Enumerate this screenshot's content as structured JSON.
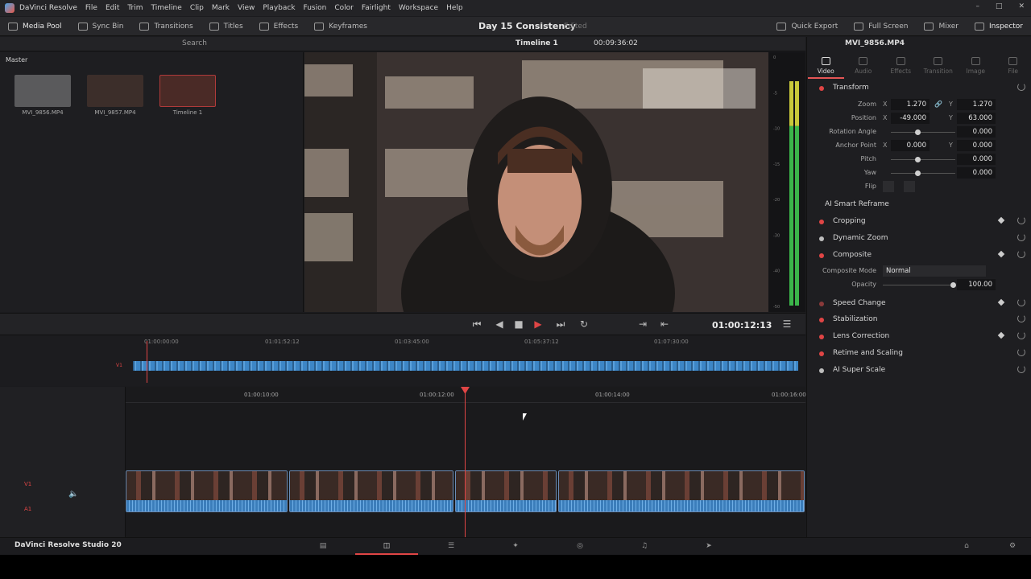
{
  "app": {
    "name": "DaVinci Resolve",
    "brand": "DaVinci Resolve Studio 20"
  },
  "menu": [
    "File",
    "Edit",
    "Trim",
    "Timeline",
    "Clip",
    "Mark",
    "View",
    "Playback",
    "Fusion",
    "Color",
    "Fairlight",
    "Workspace",
    "Help"
  ],
  "toolbar": {
    "left": [
      "Media Pool",
      "Sync Bin",
      "Transitions",
      "Titles",
      "Effects",
      "Keyframes"
    ],
    "project_title": "Day 15 Consistency",
    "project_status": "Edited",
    "right": [
      "Quick Export",
      "Full Screen",
      "Mixer",
      "Inspector"
    ]
  },
  "subbar": {
    "search_placeholder": "Search",
    "timeline_name": "Timeline 1",
    "timecode": "00:09:36:02"
  },
  "media_pool": {
    "bin": "Master",
    "clips": [
      {
        "name": "MVI_9856.MP4"
      },
      {
        "name": "MVI_9857.MP4"
      },
      {
        "name": "Timeline 1"
      }
    ]
  },
  "meter": {
    "scale": [
      "0",
      "-5",
      "-10",
      "-15",
      "-20",
      "-30",
      "-40",
      "-50"
    ],
    "level_green_pct": 0.72,
    "level_yellow_pct": 0.18
  },
  "transport": {
    "timecode": "01:00:12:13"
  },
  "ruler_upper": [
    "01:00:00:00",
    "01:01:52:12",
    "01:03:45:00",
    "01:05:37:12",
    "01:07:30:00"
  ],
  "ruler_lower": [
    "01:00:10:00",
    "01:00:12:00",
    "01:00:14:00",
    "01:00:16:00"
  ],
  "tracks": {
    "video": "V1",
    "audio": "A1"
  },
  "inspector": {
    "clip_name": "MVI_9856.MP4",
    "tabs": [
      "Video",
      "Audio",
      "Effects",
      "Transition",
      "Image",
      "File"
    ],
    "transform": {
      "title": "Transform",
      "zoom": {
        "label": "Zoom",
        "x": "1.270",
        "y": "1.270"
      },
      "position": {
        "label": "Position",
        "x": "-49.000",
        "y": "63.000"
      },
      "rotation": {
        "label": "Rotation Angle",
        "value": "0.000"
      },
      "anchor": {
        "label": "Anchor Point",
        "x": "0.000",
        "y": "0.000"
      },
      "pitch": {
        "label": "Pitch",
        "value": "0.000"
      },
      "yaw": {
        "label": "Yaw",
        "value": "0.000"
      },
      "flip": {
        "label": "Flip"
      },
      "axis_x": "X",
      "axis_y": "Y"
    },
    "ai_reframe": "AI Smart Reframe",
    "cropping": "Cropping",
    "dynamic_zoom": "Dynamic Zoom",
    "composite": {
      "title": "Composite",
      "mode_label": "Composite Mode",
      "mode": "Normal",
      "opacity_label": "Opacity",
      "opacity": "100.00"
    },
    "speed_change": "Speed Change",
    "stabilization": "Stabilization",
    "lens_correction": "Lens Correction",
    "retime": "Retime and Scaling",
    "ai_super_scale": "AI Super Scale"
  },
  "colors": {
    "accent": "#e04545",
    "clip_blue": "#3d86c6"
  }
}
